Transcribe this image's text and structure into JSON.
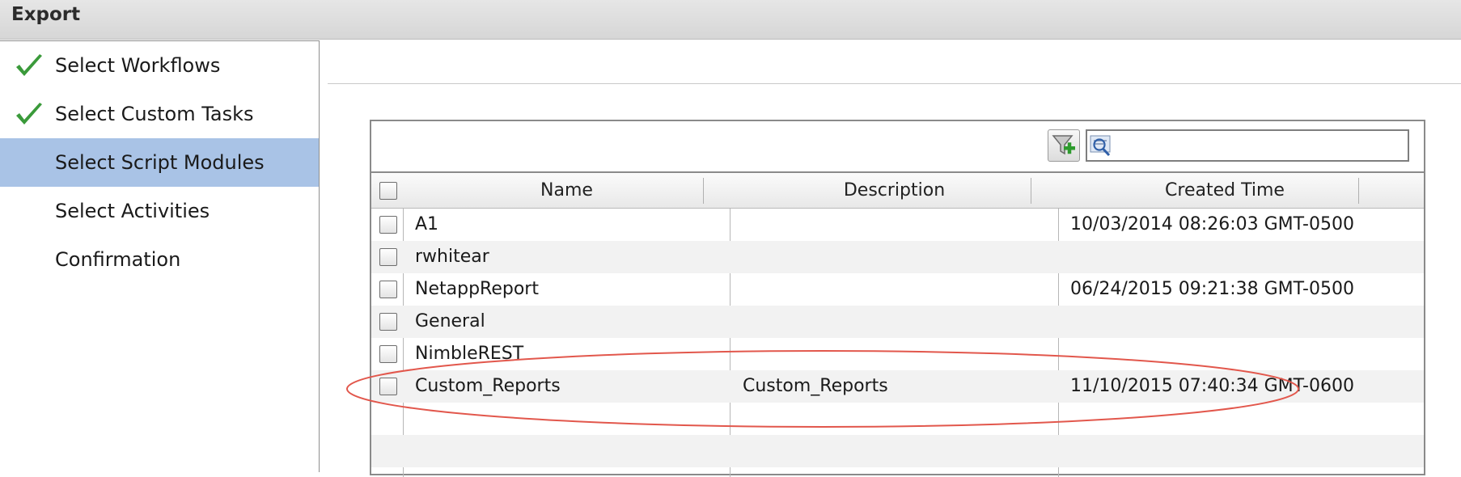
{
  "window": {
    "title": "Export"
  },
  "steps": [
    {
      "label": "Select Workflows",
      "completed": true
    },
    {
      "label": "Select Custom Tasks",
      "completed": true
    },
    {
      "label": "Select Script Modules",
      "active": true
    },
    {
      "label": "Select Activities"
    },
    {
      "label": "Confirmation"
    }
  ],
  "toolbar": {
    "search_value": "",
    "filter_icon": "add-filter-icon",
    "search_icon": "search-icon"
  },
  "table": {
    "columns": [
      "Name",
      "Description",
      "Created Time"
    ],
    "rows": [
      {
        "name": "A1",
        "description": "",
        "created": "10/03/2014 08:26:03 GMT-0500"
      },
      {
        "name": "rwhitear",
        "description": "",
        "created": ""
      },
      {
        "name": "NetappReport",
        "description": "",
        "created": "06/24/2015 09:21:38 GMT-0500"
      },
      {
        "name": "General",
        "description": "",
        "created": ""
      },
      {
        "name": "NimbleREST",
        "description": "",
        "created": ""
      },
      {
        "name": "Custom_Reports",
        "description": "Custom_Reports",
        "created": "11/10/2015 07:40:34 GMT-0600"
      }
    ]
  },
  "colors": {
    "active_step": "#a9c3e6",
    "check": "#3a9a3a",
    "highlight": "#e2574c"
  }
}
